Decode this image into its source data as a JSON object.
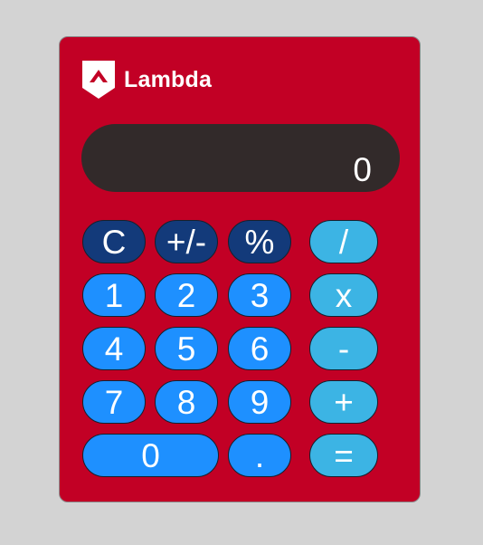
{
  "brand": {
    "name": "Lambda",
    "logo_icon": "lambda-shield-icon"
  },
  "display": {
    "value": "0"
  },
  "keys": {
    "clear": "C",
    "sign": "+/-",
    "percent": "%",
    "divide": "/",
    "multiply": "x",
    "subtract": "-",
    "add": "+",
    "equals": "=",
    "decimal": ".",
    "n0": "0",
    "n1": "1",
    "n2": "2",
    "n3": "3",
    "n4": "4",
    "n5": "5",
    "n6": "6",
    "n7": "7",
    "n8": "8",
    "n9": "9"
  },
  "colors": {
    "body": "#c20025",
    "display": "#322a2a",
    "function_keys": "#133a7a",
    "number_keys": "#1e90ff",
    "operator_keys": "#3cb4e4",
    "background": "#d3d3d3"
  }
}
